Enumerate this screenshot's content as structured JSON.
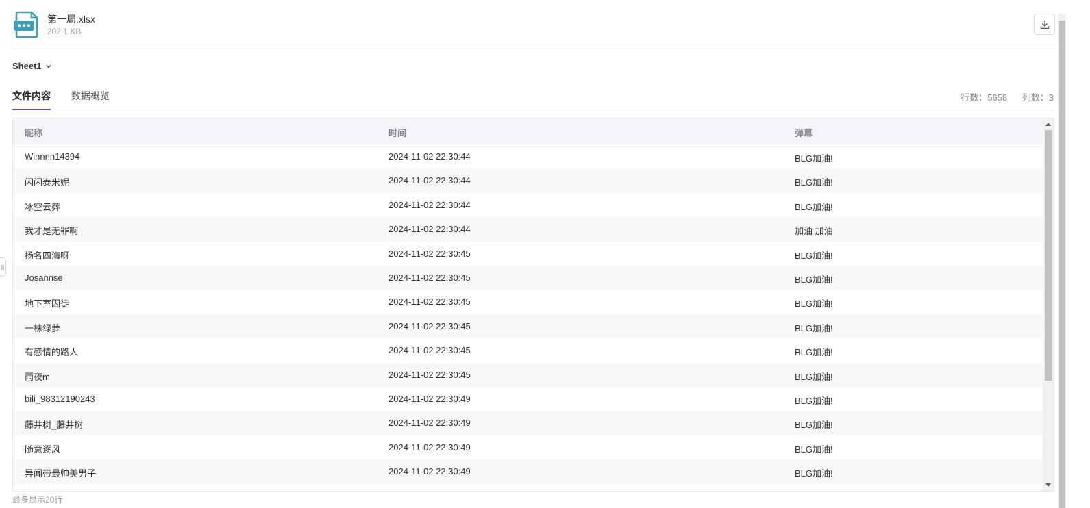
{
  "file": {
    "name": "第一局.xlsx",
    "size": "202.1 KB"
  },
  "sheet": {
    "selected": "Sheet1"
  },
  "tabs": [
    {
      "label": "文件内容",
      "active": true
    },
    {
      "label": "数据概览",
      "active": false
    }
  ],
  "stats": {
    "rows": "行数：5658",
    "cols": "列数：3"
  },
  "table": {
    "headers": [
      "昵称",
      "时间",
      "弹幕"
    ],
    "rows": [
      [
        "Winnnn14394",
        "2024-11-02 22:30:44",
        "BLG加油!"
      ],
      [
        "闪闪泰米妮",
        "2024-11-02 22:30:44",
        "BLG加油!"
      ],
      [
        "冰空云葬",
        "2024-11-02 22:30:44",
        "BLG加油!"
      ],
      [
        "我才是无罪啊",
        "2024-11-02 22:30:44",
        "加油 加油"
      ],
      [
        "扬名四海呀",
        "2024-11-02 22:30:45",
        "BLG加油!"
      ],
      [
        "Josannse",
        "2024-11-02 22:30:45",
        "BLG加油!"
      ],
      [
        "地下室囚徒",
        "2024-11-02 22:30:45",
        "BLG加油!"
      ],
      [
        "一株绿萝",
        "2024-11-02 22:30:45",
        "BLG加油!"
      ],
      [
        "有感情的路人",
        "2024-11-02 22:30:45",
        "BLG加油!"
      ],
      [
        "雨夜m",
        "2024-11-02 22:30:45",
        "BLG加油!"
      ],
      [
        "bili_98312190243",
        "2024-11-02 22:30:49",
        "BLG加油!"
      ],
      [
        "藤井树_藤井树",
        "2024-11-02 22:30:49",
        "BLG加油!"
      ],
      [
        "随意逐风",
        "2024-11-02 22:30:49",
        "BLG加油!"
      ],
      [
        "异闻带最帅美男子",
        "2024-11-02 22:30:49",
        "BLG加油!"
      ]
    ]
  },
  "footer": {
    "note": "最多显示20行"
  },
  "colors": {
    "accent": "#5b4ee6",
    "file_icon": "#3a9fb8"
  }
}
